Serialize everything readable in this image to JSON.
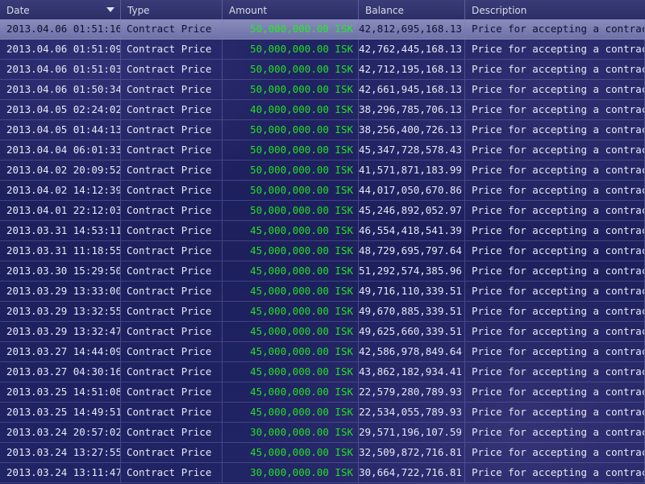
{
  "columns": {
    "date": "Date",
    "type": "Type",
    "amount": "Amount",
    "balance": "Balance",
    "description": "Description"
  },
  "sort_icon": "chevron-down-icon",
  "amount_color": "#22e022",
  "rows": [
    {
      "date": "2013.04.06  01:51:16",
      "type": "Contract Price",
      "amount": "50,000,000.00  ISK",
      "balance": "42,812,695,168.13",
      "description": "Price for accepting a contract"
    },
    {
      "date": "2013.04.06  01:51:09",
      "type": "Contract Price",
      "amount": "50,000,000.00  ISK",
      "balance": "42,762,445,168.13",
      "description": "Price for accepting a contract"
    },
    {
      "date": "2013.04.06  01:51:03",
      "type": "Contract Price",
      "amount": "50,000,000.00  ISK",
      "balance": "42,712,195,168.13",
      "description": "Price for accepting a contract"
    },
    {
      "date": "2013.04.06  01:50:34",
      "type": "Contract Price",
      "amount": "50,000,000.00  ISK",
      "balance": "42,661,945,168.13",
      "description": "Price for accepting a contract"
    },
    {
      "date": "2013.04.05  02:24:02",
      "type": "Contract Price",
      "amount": "40,000,000.00  ISK",
      "balance": "38,296,785,706.13",
      "description": "Price for accepting a contract"
    },
    {
      "date": "2013.04.05  01:44:13",
      "type": "Contract Price",
      "amount": "50,000,000.00  ISK",
      "balance": "38,256,400,726.13",
      "description": "Price for accepting a contract"
    },
    {
      "date": "2013.04.04  06:01:33",
      "type": "Contract Price",
      "amount": "50,000,000.00  ISK",
      "balance": "45,347,728,578.43",
      "description": "Price for accepting a contract"
    },
    {
      "date": "2013.04.02  20:09:52",
      "type": "Contract Price",
      "amount": "50,000,000.00  ISK",
      "balance": "41,571,871,183.99",
      "description": "Price for accepting a contract"
    },
    {
      "date": "2013.04.02  14:12:39",
      "type": "Contract Price",
      "amount": "50,000,000.00  ISK",
      "balance": "44,017,050,670.86",
      "description": "Price for accepting a contract"
    },
    {
      "date": "2013.04.01  22:12:03",
      "type": "Contract Price",
      "amount": "50,000,000.00  ISK",
      "balance": "45,246,892,052.97",
      "description": "Price for accepting a contract"
    },
    {
      "date": "2013.03.31  14:53:11",
      "type": "Contract Price",
      "amount": "45,000,000.00  ISK",
      "balance": "46,554,418,541.39",
      "description": "Price for accepting a contract"
    },
    {
      "date": "2013.03.31  11:18:55",
      "type": "Contract Price",
      "amount": "45,000,000.00  ISK",
      "balance": "48,729,695,797.64",
      "description": "Price for accepting a contract"
    },
    {
      "date": "2013.03.30  15:29:50",
      "type": "Contract Price",
      "amount": "45,000,000.00  ISK",
      "balance": "51,292,574,385.96",
      "description": "Price for accepting a contract"
    },
    {
      "date": "2013.03.29  13:33:00",
      "type": "Contract Price",
      "amount": "45,000,000.00  ISK",
      "balance": "49,716,110,339.51",
      "description": "Price for accepting a contract"
    },
    {
      "date": "2013.03.29  13:32:55",
      "type": "Contract Price",
      "amount": "45,000,000.00  ISK",
      "balance": "49,670,885,339.51",
      "description": "Price for accepting a contract"
    },
    {
      "date": "2013.03.29  13:32:47",
      "type": "Contract Price",
      "amount": "45,000,000.00  ISK",
      "balance": "49,625,660,339.51",
      "description": "Price for accepting a contract"
    },
    {
      "date": "2013.03.27  14:44:09",
      "type": "Contract Price",
      "amount": "45,000,000.00  ISK",
      "balance": "42,586,978,849.64",
      "description": "Price for accepting a contract"
    },
    {
      "date": "2013.03.27  04:30:16",
      "type": "Contract Price",
      "amount": "45,000,000.00  ISK",
      "balance": "43,862,182,934.41",
      "description": "Price for accepting a contract"
    },
    {
      "date": "2013.03.25  14:51:08",
      "type": "Contract Price",
      "amount": "45,000,000.00  ISK",
      "balance": "22,579,280,789.93",
      "description": "Price for accepting a contract"
    },
    {
      "date": "2013.03.25  14:49:51",
      "type": "Contract Price",
      "amount": "45,000,000.00  ISK",
      "balance": "22,534,055,789.93",
      "description": "Price for accepting a contract"
    },
    {
      "date": "2013.03.24  20:57:02",
      "type": "Contract Price",
      "amount": "30,000,000.00  ISK",
      "balance": "29,571,196,107.59",
      "description": "Price for accepting a contract"
    },
    {
      "date": "2013.03.24  13:27:55",
      "type": "Contract Price",
      "amount": "45,000,000.00  ISK",
      "balance": "32,509,872,716.81",
      "description": "Price for accepting a contract"
    },
    {
      "date": "2013.03.24  13:11:47",
      "type": "Contract Price",
      "amount": "30,000,000.00  ISK",
      "balance": "30,664,722,716.81",
      "description": "Price for accepting a contract"
    }
  ]
}
